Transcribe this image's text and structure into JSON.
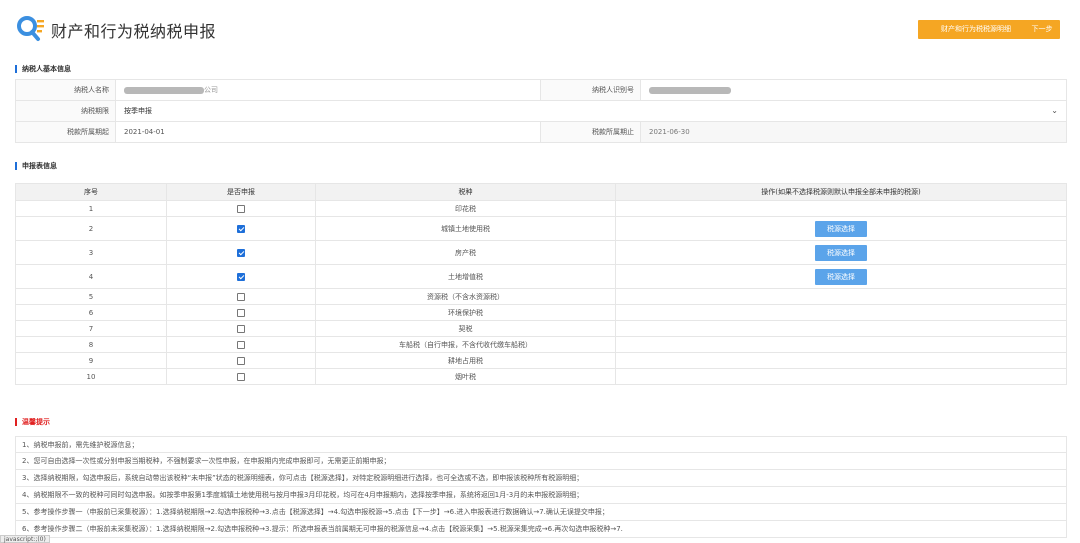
{
  "header": {
    "title": "财产和行为税纳税申报",
    "detail_button": "财产和行为税税源明细",
    "next_button": "下一步"
  },
  "taxpayer_section": {
    "title": "纳税人基本信息",
    "name_label": "纳税人名称",
    "name_suffix": "公司",
    "id_label": "纳税人识别号",
    "period_label": "纳税期限",
    "period_value": "按季申报",
    "start_label": "税款所属期起",
    "start_value": "2021-04-01",
    "end_label": "税款所属期止",
    "end_value": "2021-06-30"
  },
  "declaration_section": {
    "title": "申报表信息",
    "columns": [
      "序号",
      "是否申报",
      "税种",
      "操作(如果不选择税源则默认申报全部未申报的税源)"
    ],
    "source_button": "税源选择",
    "rows": [
      {
        "no": "1",
        "tax": "印花税",
        "checked": false,
        "button": false
      },
      {
        "no": "2",
        "tax": "城镇土地使用税",
        "checked": true,
        "button": true
      },
      {
        "no": "3",
        "tax": "房产税",
        "checked": true,
        "button": true
      },
      {
        "no": "4",
        "tax": "土地增值税",
        "checked": true,
        "button": true
      },
      {
        "no": "5",
        "tax": "资源税（不含水资源税）",
        "checked": false,
        "button": false
      },
      {
        "no": "6",
        "tax": "环境保护税",
        "checked": false,
        "button": false
      },
      {
        "no": "7",
        "tax": "契税",
        "checked": false,
        "button": false
      },
      {
        "no": "8",
        "tax": "车船税（自行申报，不含代收代缴车船税）",
        "checked": false,
        "button": false
      },
      {
        "no": "9",
        "tax": "耕地占用税",
        "checked": false,
        "button": false
      },
      {
        "no": "10",
        "tax": "烟叶税",
        "checked": false,
        "button": false
      }
    ]
  },
  "tips_section": {
    "title": "温馨提示",
    "items": [
      "1、纳税申报前，需先维护税源信息；",
      "2、您可自由选择一次性或分别申报当期税种，不强制要求一次性申报，在申报期内完成申报即可，无需更正前期申报；",
      "3、选择纳税期限，勾选申报后，系统自动带出该税种“未申报”状态的税源明细表，你可点击【税源选择】，对特定税源明细进行选择，也可全选或不选，即申报该税种所有税源明细；",
      "4、纳税期限不一致的税种可同时勾选申报。如按季申报第1季度城镇土地使用税与按月申报3月印花税，均可在4月申报期内，选择按季申报，系统将返回1月-3月的未申报税源明细；",
      "5、参考操作步骤一（申报前已采集税源）：1.选择纳税期限→2.勾选申报税种→3.点击【税源选择】→4.勾选申报税源→5.点击【下一步】→6.进入申报表进行数据确认→7.确认无误提交申报；",
      "6、参考操作步骤二（申报前未采集税源）：1.选择纳税期限→2.勾选申报税种→3.提示：所选申报表当前属期无可申报的税源信息→4.点击【税源采集】→5.税源采集完成→6.再次勾选申报税种→7."
    ]
  },
  "statusbar": {
    "text": "javascript:;(0)"
  },
  "colors": {
    "accent_blue": "#1e6fd9",
    "orange_button": "#f5a623",
    "blue_button": "#5ba4ea",
    "warning_red": "#e02020"
  },
  "icons": {
    "logo": "search-document-icon",
    "select": "chevron-down-icon"
  }
}
